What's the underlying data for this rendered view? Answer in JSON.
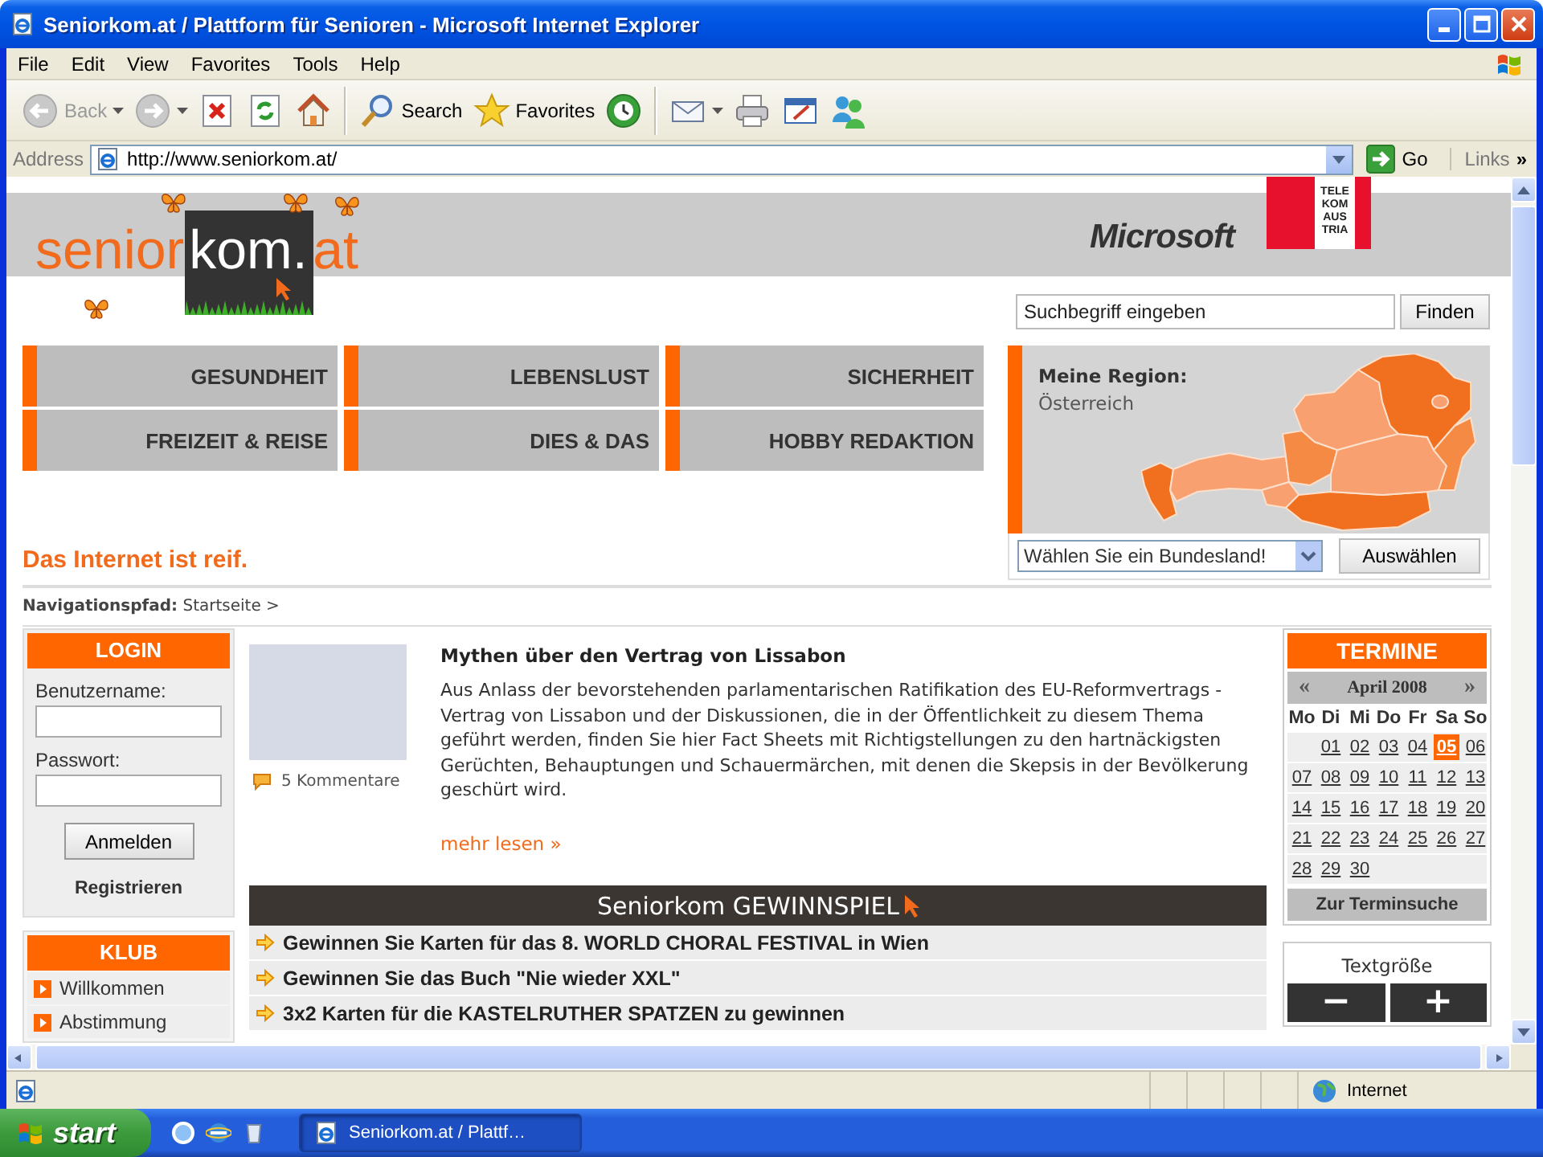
{
  "window": {
    "title": "Seniorkom.at / Plattform für Senioren - Microsoft Internet Explorer"
  },
  "menu": [
    "File",
    "Edit",
    "View",
    "Favorites",
    "Tools",
    "Help"
  ],
  "toolbar": [
    {
      "kind": "back",
      "label": "Back",
      "disabled": true
    },
    {
      "kind": "forward",
      "disabled": true
    },
    {
      "kind": "stop",
      "disabled": false
    },
    {
      "kind": "refresh",
      "disabled": false
    },
    {
      "kind": "home",
      "disabled": false
    },
    {
      "kind": "search",
      "label": "Search",
      "disabled": false
    },
    {
      "kind": "favorites",
      "label": "Favorites",
      "disabled": false
    },
    {
      "kind": "history",
      "disabled": false
    },
    {
      "kind": "mail",
      "disabled": false
    },
    {
      "kind": "print",
      "disabled": false
    },
    {
      "kind": "edit",
      "disabled": false
    },
    {
      "kind": "messenger",
      "disabled": false
    }
  ],
  "address": {
    "label": "Address",
    "url": "http://www.seniorkom.at/",
    "go": "Go",
    "links": "Links",
    "more": "»"
  },
  "page": {
    "logo": [
      {
        "text": "senior",
        "kind": "plain"
      },
      {
        "text": "kom.",
        "kind": "tile"
      },
      {
        "text": "at",
        "kind": "plain"
      }
    ],
    "sponsors": {
      "microsoft": "Microsoft",
      "telekom": [
        "TELE",
        "KOM",
        "AUS",
        "TRIA"
      ]
    },
    "search": {
      "placeholder": "Suchbegriff eingeben",
      "button": "Finden"
    },
    "nav": [
      "GESUNDHEIT",
      "LEBENSLUST",
      "SICHERHEIT",
      "FREIZEIT & REISE",
      "DIES & DAS",
      "HOBBY REDAKTION"
    ],
    "tagline": "Das Internet ist reif.",
    "region": {
      "heading": "Meine Region:",
      "value": "Österreich",
      "select": "Wählen Sie ein Bundesland!",
      "button": "Auswählen"
    },
    "breadcrumb": "**Navigationspfad:** Startseite >",
    "login": {
      "title": "LOGIN",
      "username_label": "Benutzername:",
      "password_label": "Passwort:",
      "submit": "Anmelden",
      "register": "Registrieren"
    },
    "klub": {
      "title": "KLUB",
      "items": [
        "Willkommen",
        "Abstimmung"
      ]
    },
    "article": {
      "title": "Mythen über den Vertrag von Lissabon",
      "body": "Aus Anlass der bevorstehenden parlamentarischen Ratifikation des EU-Reformvertrags - Vertrag von Lissabon und der Diskussionen, die in der Öffentlichkeit zu diesem Thema geführt werden, finden Sie hier Fact Sheets mit Richtigstellungen zu den hartnäckigsten Gerüchten, Behauptungen und Schauermärchen, mit denen die Skepsis in der Bevölkerung geschürt wird.",
      "comments": "5 Kommentare",
      "more": "mehr lesen »"
    },
    "contest": {
      "title": "Seniorkom GEWINNSPIEL",
      "items": [
        "Gewinnen Sie Karten für das 8. WORLD CHORAL FESTIVAL in Wien",
        "Gewinnen Sie das Buch \"Nie wieder XXL\"",
        "3x2 Karten für die KASTELRUTHER SPATZEN zu gewinnen"
      ]
    },
    "calendar": {
      "title": "TERMINE",
      "prev": "«",
      "month": "April 2008",
      "next": "»",
      "weekdays": [
        "Mo",
        "Di",
        "Mi",
        "Do",
        "Fr",
        "Sa",
        "So"
      ],
      "weeks": [
        [
          {
            "day": "01",
            "selected": false
          },
          {
            "day": "02",
            "selected": false
          },
          {
            "day": "03",
            "selected": false
          },
          {
            "day": "04",
            "selected": false
          },
          {
            "day": "05",
            "selected": true
          },
          {
            "day": "06",
            "selected": false
          }
        ],
        [
          {
            "day": "07",
            "selected": false
          },
          {
            "day": "08",
            "selected": false
          },
          {
            "day": "09",
            "selected": false
          },
          {
            "day": "10",
            "selected": false
          },
          {
            "day": "11",
            "selected": false
          },
          {
            "day": "12",
            "selected": false
          },
          {
            "day": "13",
            "selected": false
          }
        ],
        [
          {
            "day": "14",
            "selected": false
          },
          {
            "day": "15",
            "selected": false
          },
          {
            "day": "16",
            "selected": false
          },
          {
            "day": "17",
            "selected": false
          },
          {
            "day": "18",
            "selected": false
          },
          {
            "day": "19",
            "selected": false
          },
          {
            "day": "20",
            "selected": false
          }
        ],
        [
          {
            "day": "21",
            "selected": false
          },
          {
            "day": "22",
            "selected": false
          },
          {
            "day": "23",
            "selected": false
          },
          {
            "day": "24",
            "selected": false
          },
          {
            "day": "25",
            "selected": false
          },
          {
            "day": "26",
            "selected": false
          },
          {
            "day": "27",
            "selected": false
          }
        ],
        [
          {
            "day": "28",
            "selected": false
          },
          {
            "day": "29",
            "selected": false
          },
          {
            "day": "30",
            "selected": false
          }
        ]
      ],
      "search": "Zur Terminsuche"
    },
    "text_size": {
      "label": "Textgröße",
      "decrease": "−",
      "increase": "+"
    }
  },
  "status_bar": {
    "zone": "Internet"
  },
  "taskbar": {
    "start": "start",
    "tasks": [
      "Seniorkom.at / Plattf…"
    ]
  }
}
